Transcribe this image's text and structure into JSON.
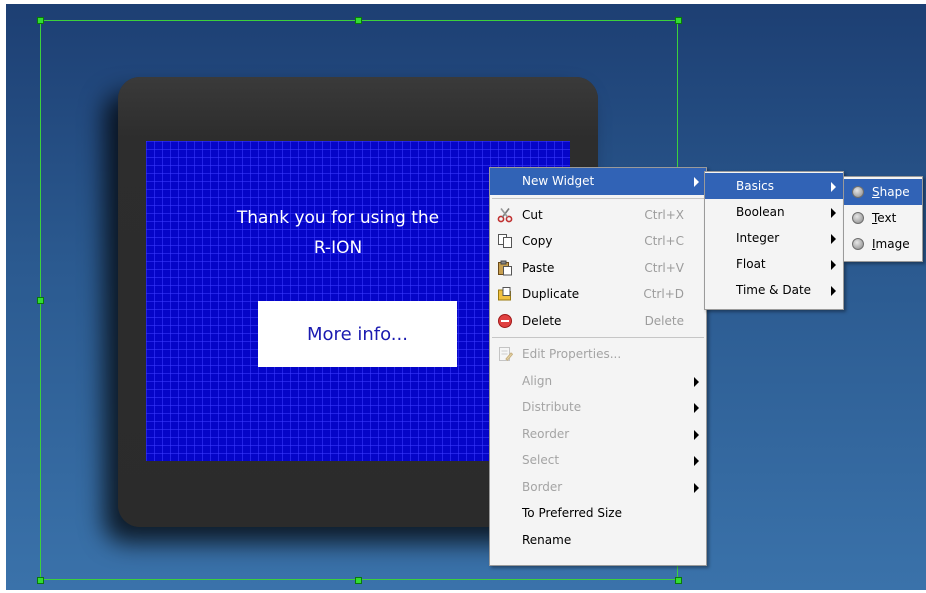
{
  "screen": {
    "thanks_line1": "Thank you for using the",
    "thanks_line2": "R-ION",
    "more_info_label": "More info..."
  },
  "context_menu": {
    "items": [
      {
        "label": "New Widget",
        "submenu": true,
        "highlighted": true
      },
      {
        "label": "Cut",
        "shortcut": "Ctrl+X",
        "icon": "scissors-icon"
      },
      {
        "label": "Copy",
        "shortcut": "Ctrl+C",
        "icon": "copy-icon"
      },
      {
        "label": "Paste",
        "shortcut": "Ctrl+V",
        "icon": "paste-icon"
      },
      {
        "label": "Duplicate",
        "shortcut": "Ctrl+D",
        "icon": "duplicate-icon"
      },
      {
        "label": "Delete",
        "shortcut": "Delete",
        "icon": "delete-icon"
      },
      {
        "label": "Edit Properties...",
        "disabled": true,
        "icon": "edit-properties-icon"
      },
      {
        "label": "Align",
        "disabled": true,
        "submenu": true
      },
      {
        "label": "Distribute",
        "disabled": true,
        "submenu": true
      },
      {
        "label": "Reorder",
        "disabled": true,
        "submenu": true
      },
      {
        "label": "Select",
        "disabled": true,
        "submenu": true
      },
      {
        "label": "Border",
        "disabled": true,
        "submenu": true
      },
      {
        "label": "To Preferred Size"
      },
      {
        "label": "Rename"
      }
    ]
  },
  "new_widget_submenu": {
    "items": [
      {
        "label": "Basics",
        "highlighted": true
      },
      {
        "label": "Boolean"
      },
      {
        "label": "Integer"
      },
      {
        "label": "Float"
      },
      {
        "label": "Time & Date"
      }
    ]
  },
  "basics_submenu": {
    "items": [
      {
        "label": "Shape",
        "mnemonic": "S",
        "rest": "hape",
        "highlighted": true
      },
      {
        "label": "Text",
        "mnemonic": "T",
        "rest": "ext"
      },
      {
        "label": "Image",
        "mnemonic": "I",
        "rest": "mage"
      }
    ]
  },
  "colors": {
    "menu_highlight": "#3163b6",
    "screen_blue": "#0505c8",
    "selection_green": "#3cd03c"
  }
}
